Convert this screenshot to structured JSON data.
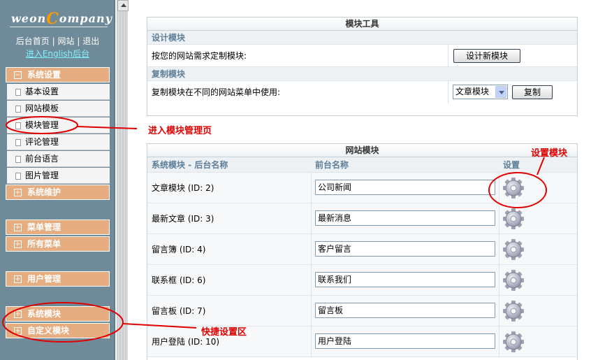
{
  "sidebar": {
    "logo_text_pre": "weon",
    "logo_text_c": "C",
    "logo_text_post": "ompany",
    "links": {
      "home": "后台首页",
      "site": "网站",
      "logout": "退出",
      "sep": "|"
    },
    "english_link": "进入English后台",
    "groups": [
      {
        "label": "系统设置",
        "box": "−"
      },
      {
        "label": "系统维护",
        "box": "+"
      },
      {
        "label": "菜单管理",
        "box": "+"
      },
      {
        "label": "所有菜单",
        "box": "+"
      },
      {
        "label": "用户管理",
        "box": "+"
      },
      {
        "label": "系统模块",
        "box": "+"
      },
      {
        "label": "自定义模块",
        "box": "+"
      }
    ],
    "items": [
      "基本设置",
      "网站模板",
      "模块管理",
      "评论管理",
      "前台语言",
      "图片管理"
    ]
  },
  "tools": {
    "title": "模块工具",
    "design": {
      "heading": "设计模块",
      "label": "按您的网站需求定制模块:",
      "button": "设计新模块"
    },
    "copy": {
      "heading": "复制模块",
      "label": "复制模块在不同的网站菜单中使用:",
      "select": "文章模块",
      "button": "复制"
    }
  },
  "modules": {
    "title": "网站模块",
    "columns": [
      "系统模块 - 后台名称",
      "前台名称",
      "设置"
    ],
    "rows": [
      {
        "name": "文章模块 (ID: 2)",
        "front": "公司新闻"
      },
      {
        "name": "最新文章 (ID: 3)",
        "front": "最新消息"
      },
      {
        "name": "留言簿 (ID: 4)",
        "front": "客户留言"
      },
      {
        "name": "联系框 (ID: 6)",
        "front": "联系我们"
      },
      {
        "name": "留言板 (ID: 7)",
        "front": "留言板"
      },
      {
        "name": "用户登陆 (ID: 10)",
        "front": "用户登陆"
      }
    ]
  },
  "annotations": {
    "module_mgmt": "进入模块管理页",
    "set_module": "设置模块",
    "quick_area": "快捷设置区"
  },
  "colors": {
    "annotation": "#e00000",
    "sidebar": "#6f8a99",
    "group": "#e6ad80",
    "heading": "#5e7f99"
  }
}
